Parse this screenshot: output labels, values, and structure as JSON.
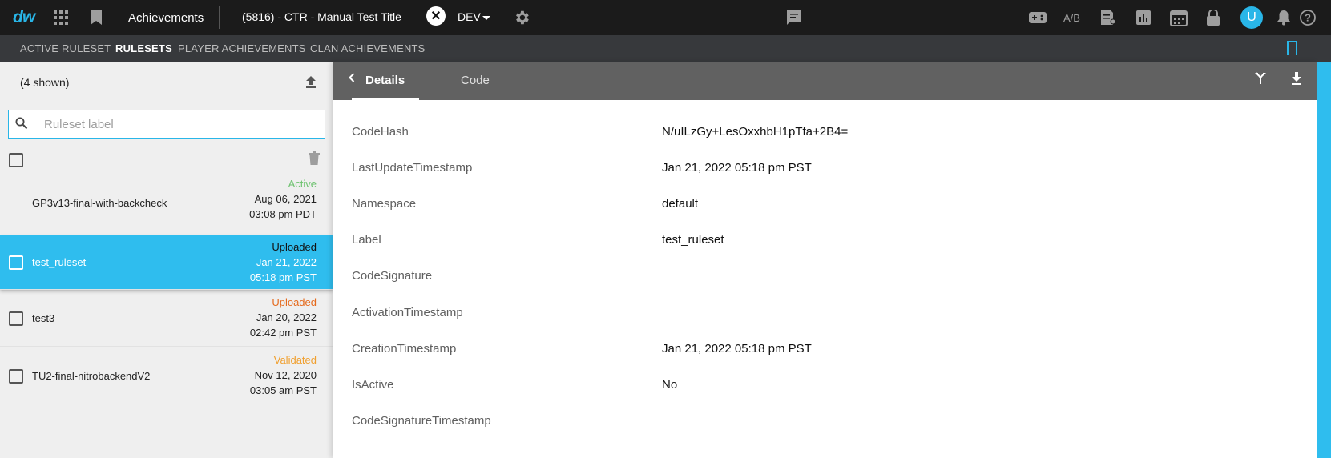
{
  "topbar": {
    "logo": "dw",
    "app_title": "Achievements",
    "title_select": "(5816) - CTR - Manual Test Title",
    "environment": "DEV",
    "ab_label": "A/B",
    "avatar_letter": "U",
    "icons": [
      "apps-grid-icon",
      "bookmark-icon",
      "xbox-icon",
      "settings-gear-icon",
      "chat-icon",
      "gamepad-icon",
      "ab-test-icon",
      "document-icon",
      "bar-chart-icon",
      "calendar-icon",
      "lock-icon",
      "notification-bell-icon",
      "help-icon"
    ]
  },
  "subnav": {
    "tabs": [
      {
        "label": "ACTIVE RULESET",
        "active": false
      },
      {
        "label": "RULESETS",
        "active": true
      },
      {
        "label": "PLAYER ACHIEVEMENTS",
        "active": false
      },
      {
        "label": "CLAN ACHIEVEMENTS",
        "active": false
      }
    ]
  },
  "list": {
    "shown_count": "(4 shown)",
    "search_placeholder": "Ruleset label",
    "items": [
      {
        "name": "GP3v13-final-with-backcheck",
        "status": "Active",
        "date": "Aug 06, 2021",
        "time": "03:08 pm PDT",
        "selected": false
      },
      {
        "name": "test_ruleset",
        "status": "Uploaded",
        "date": "Jan 21, 2022",
        "time": "05:18 pm PST",
        "selected": true
      },
      {
        "name": "test3",
        "status": "Uploaded",
        "date": "Jan 20, 2022",
        "time": "02:42 pm PST",
        "selected": false
      },
      {
        "name": "TU2-final-nitrobackendV2",
        "status": "Validated",
        "date": "Nov 12, 2020",
        "time": "03:05 am PST",
        "selected": false
      }
    ]
  },
  "detail": {
    "tabs": [
      {
        "label": "Details",
        "active": true
      },
      {
        "label": "Code",
        "active": false
      }
    ],
    "fields": [
      {
        "label": "CodeHash",
        "value": "N/uILzGy+LesOxxhbH1pTfa+2B4="
      },
      {
        "label": "LastUpdateTimestamp",
        "value": "Jan 21, 2022 05:18 pm PST"
      },
      {
        "label": "Namespace",
        "value": "default"
      },
      {
        "label": "Label",
        "value": "test_ruleset"
      },
      {
        "label": "CodeSignature",
        "value": ""
      },
      {
        "label": "ActivationTimestamp",
        "value": ""
      },
      {
        "label": "CreationTimestamp",
        "value": "Jan 21, 2022 05:18 pm PST"
      },
      {
        "label": "IsActive",
        "value": "No"
      },
      {
        "label": "CodeSignatureTimestamp",
        "value": ""
      }
    ]
  },
  "colors": {
    "accent": "#2fbdee",
    "status_active": "#6cc26e",
    "status_uploaded": "#e56a1d",
    "status_validated": "#f0a030"
  }
}
